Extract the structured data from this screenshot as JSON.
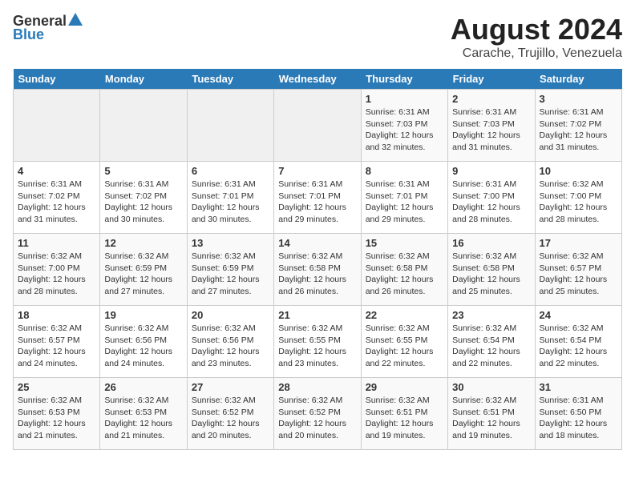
{
  "logo": {
    "general": "General",
    "blue": "Blue"
  },
  "title": "August 2024",
  "subtitle": "Carache, Trujillo, Venezuela",
  "days_of_week": [
    "Sunday",
    "Monday",
    "Tuesday",
    "Wednesday",
    "Thursday",
    "Friday",
    "Saturday"
  ],
  "weeks": [
    [
      {
        "day": "",
        "info": ""
      },
      {
        "day": "",
        "info": ""
      },
      {
        "day": "",
        "info": ""
      },
      {
        "day": "",
        "info": ""
      },
      {
        "day": "1",
        "info": "Sunrise: 6:31 AM\nSunset: 7:03 PM\nDaylight: 12 hours\nand 32 minutes."
      },
      {
        "day": "2",
        "info": "Sunrise: 6:31 AM\nSunset: 7:03 PM\nDaylight: 12 hours\nand 31 minutes."
      },
      {
        "day": "3",
        "info": "Sunrise: 6:31 AM\nSunset: 7:02 PM\nDaylight: 12 hours\nand 31 minutes."
      }
    ],
    [
      {
        "day": "4",
        "info": "Sunrise: 6:31 AM\nSunset: 7:02 PM\nDaylight: 12 hours\nand 31 minutes."
      },
      {
        "day": "5",
        "info": "Sunrise: 6:31 AM\nSunset: 7:02 PM\nDaylight: 12 hours\nand 30 minutes."
      },
      {
        "day": "6",
        "info": "Sunrise: 6:31 AM\nSunset: 7:01 PM\nDaylight: 12 hours\nand 30 minutes."
      },
      {
        "day": "7",
        "info": "Sunrise: 6:31 AM\nSunset: 7:01 PM\nDaylight: 12 hours\nand 29 minutes."
      },
      {
        "day": "8",
        "info": "Sunrise: 6:31 AM\nSunset: 7:01 PM\nDaylight: 12 hours\nand 29 minutes."
      },
      {
        "day": "9",
        "info": "Sunrise: 6:31 AM\nSunset: 7:00 PM\nDaylight: 12 hours\nand 28 minutes."
      },
      {
        "day": "10",
        "info": "Sunrise: 6:32 AM\nSunset: 7:00 PM\nDaylight: 12 hours\nand 28 minutes."
      }
    ],
    [
      {
        "day": "11",
        "info": "Sunrise: 6:32 AM\nSunset: 7:00 PM\nDaylight: 12 hours\nand 28 minutes."
      },
      {
        "day": "12",
        "info": "Sunrise: 6:32 AM\nSunset: 6:59 PM\nDaylight: 12 hours\nand 27 minutes."
      },
      {
        "day": "13",
        "info": "Sunrise: 6:32 AM\nSunset: 6:59 PM\nDaylight: 12 hours\nand 27 minutes."
      },
      {
        "day": "14",
        "info": "Sunrise: 6:32 AM\nSunset: 6:58 PM\nDaylight: 12 hours\nand 26 minutes."
      },
      {
        "day": "15",
        "info": "Sunrise: 6:32 AM\nSunset: 6:58 PM\nDaylight: 12 hours\nand 26 minutes."
      },
      {
        "day": "16",
        "info": "Sunrise: 6:32 AM\nSunset: 6:58 PM\nDaylight: 12 hours\nand 25 minutes."
      },
      {
        "day": "17",
        "info": "Sunrise: 6:32 AM\nSunset: 6:57 PM\nDaylight: 12 hours\nand 25 minutes."
      }
    ],
    [
      {
        "day": "18",
        "info": "Sunrise: 6:32 AM\nSunset: 6:57 PM\nDaylight: 12 hours\nand 24 minutes."
      },
      {
        "day": "19",
        "info": "Sunrise: 6:32 AM\nSunset: 6:56 PM\nDaylight: 12 hours\nand 24 minutes."
      },
      {
        "day": "20",
        "info": "Sunrise: 6:32 AM\nSunset: 6:56 PM\nDaylight: 12 hours\nand 23 minutes."
      },
      {
        "day": "21",
        "info": "Sunrise: 6:32 AM\nSunset: 6:55 PM\nDaylight: 12 hours\nand 23 minutes."
      },
      {
        "day": "22",
        "info": "Sunrise: 6:32 AM\nSunset: 6:55 PM\nDaylight: 12 hours\nand 22 minutes."
      },
      {
        "day": "23",
        "info": "Sunrise: 6:32 AM\nSunset: 6:54 PM\nDaylight: 12 hours\nand 22 minutes."
      },
      {
        "day": "24",
        "info": "Sunrise: 6:32 AM\nSunset: 6:54 PM\nDaylight: 12 hours\nand 22 minutes."
      }
    ],
    [
      {
        "day": "25",
        "info": "Sunrise: 6:32 AM\nSunset: 6:53 PM\nDaylight: 12 hours\nand 21 minutes."
      },
      {
        "day": "26",
        "info": "Sunrise: 6:32 AM\nSunset: 6:53 PM\nDaylight: 12 hours\nand 21 minutes."
      },
      {
        "day": "27",
        "info": "Sunrise: 6:32 AM\nSunset: 6:52 PM\nDaylight: 12 hours\nand 20 minutes."
      },
      {
        "day": "28",
        "info": "Sunrise: 6:32 AM\nSunset: 6:52 PM\nDaylight: 12 hours\nand 20 minutes."
      },
      {
        "day": "29",
        "info": "Sunrise: 6:32 AM\nSunset: 6:51 PM\nDaylight: 12 hours\nand 19 minutes."
      },
      {
        "day": "30",
        "info": "Sunrise: 6:32 AM\nSunset: 6:51 PM\nDaylight: 12 hours\nand 19 minutes."
      },
      {
        "day": "31",
        "info": "Sunrise: 6:31 AM\nSunset: 6:50 PM\nDaylight: 12 hours\nand 18 minutes."
      }
    ]
  ]
}
